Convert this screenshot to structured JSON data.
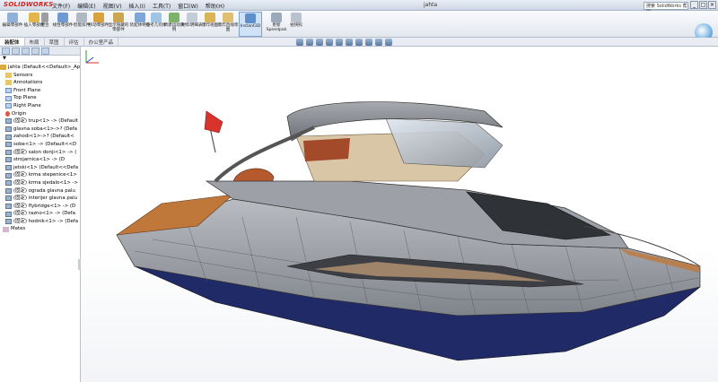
{
  "app": {
    "brand": "SOLIDWORKS",
    "doc_title": "jahta",
    "help_search": "搜索 SolidWorks 帮助"
  },
  "menu": [
    "文件(F)",
    "编辑(E)",
    "视图(V)",
    "插入(I)",
    "工具(T)",
    "窗口(W)",
    "帮助(H)"
  ],
  "window_buttons": [
    "_",
    "□",
    "×"
  ],
  "toolbar": {
    "buttons": [
      {
        "label": "编辑零部件",
        "icon": "edit-component-icon"
      },
      {
        "label": "插入零部件",
        "icon": "insert-component-icon"
      },
      {
        "label": "配合",
        "icon": "mate-icon"
      },
      {
        "label": "线性零部件",
        "icon": "linear-pattern-icon"
      },
      {
        "label": "智能扣件",
        "icon": "smart-fastener-icon"
      },
      {
        "label": "移动零部件",
        "icon": "move-component-icon"
      },
      {
        "label": "显示隐藏的零部件",
        "icon": "show-hidden-icon"
      },
      {
        "label": "装配体特征",
        "icon": "assembly-feature-icon"
      },
      {
        "label": "参考几何体",
        "icon": "reference-geometry-icon"
      },
      {
        "label": "新建运动算例",
        "icon": "new-motion-study-icon"
      },
      {
        "label": "材料明细表",
        "icon": "bom-icon"
      },
      {
        "label": "爆炸视图",
        "icon": "exploded-view-icon"
      },
      {
        "label": "爆炸直线草图",
        "icon": "explode-line-sketch-icon"
      },
      {
        "label": "Instant3D",
        "icon": "instant3d-icon"
      },
      {
        "label": "更新Speedpak",
        "icon": "speedpak-icon"
      },
      {
        "label": "拍快照",
        "icon": "snapshot-icon"
      }
    ],
    "active": "Instant3D"
  },
  "tabs": [
    "装配体",
    "布局",
    "草图",
    "评估",
    "办公室产品"
  ],
  "active_tab": "装配体",
  "tree": {
    "root": "jahta  (Default<<Default>_Ap",
    "items": [
      {
        "label": "Sensors",
        "icon": "folder"
      },
      {
        "label": "Annotations",
        "icon": "folder"
      },
      {
        "label": "Front Plane",
        "icon": "plane"
      },
      {
        "label": "Top Plane",
        "icon": "plane"
      },
      {
        "label": "Right Plane",
        "icon": "plane"
      },
      {
        "label": "Origin",
        "icon": "origin"
      },
      {
        "label": "(固定) trup<1> -> (Default",
        "icon": "part"
      },
      {
        "label": "glavna soba<1>->? (Defa",
        "icon": "part"
      },
      {
        "label": "zahodi<1>->? (Default<",
        "icon": "part"
      },
      {
        "label": "sobe<1> -> (Default<<D",
        "icon": "part"
      },
      {
        "label": "(固定) salon donji<1> -> (",
        "icon": "part"
      },
      {
        "label": "strojarnica<1> -> (D",
        "icon": "part"
      },
      {
        "label": "jetski<1> (Default<<Defa",
        "icon": "part"
      },
      {
        "label": "(固定) krma stepenice<1>",
        "icon": "part"
      },
      {
        "label": "(固定) krma sjedalo<1> ->",
        "icon": "part"
      },
      {
        "label": "(固定) ograda glavna palu",
        "icon": "part"
      },
      {
        "label": "(固定) interijer glavna palu",
        "icon": "part"
      },
      {
        "label": "(固定) flybridge<1> -> (D",
        "icon": "part"
      },
      {
        "label": "(固定) razno<1> -> (Defa",
        "icon": "part"
      },
      {
        "label": "(固定) hodnik<1> -> (Defa",
        "icon": "part"
      },
      {
        "label": "Mates",
        "icon": "mates"
      }
    ]
  },
  "model": {
    "name": "yacht-assembly",
    "flag_color": "#d9342b",
    "hull_color": "#8f939a",
    "waterline_color": "#1f2a66",
    "deck_color": "#c0783a"
  }
}
